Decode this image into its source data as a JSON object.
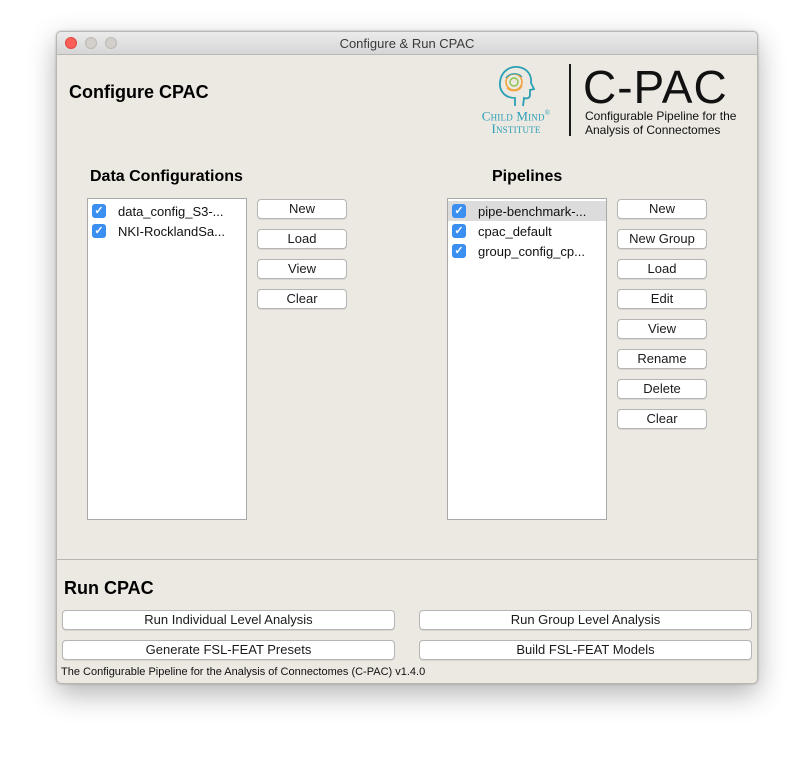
{
  "window": {
    "title": "Configure & Run CPAC"
  },
  "header": {
    "title": "Configure CPAC"
  },
  "logo": {
    "institute_line1": "Child Mind",
    "institute_line2": "Institute",
    "registered": "®",
    "product": "C-PAC",
    "subtitle_line1": "Configurable Pipeline for the",
    "subtitle_line2": "Analysis of Connectomes"
  },
  "data_configs": {
    "title": "Data Configurations",
    "items": [
      {
        "label": "data_config_S3-...",
        "checked": true
      },
      {
        "label": "NKI-RocklandSa...",
        "checked": true
      }
    ],
    "buttons": [
      "New",
      "Load",
      "View",
      "Clear"
    ]
  },
  "pipelines": {
    "title": "Pipelines",
    "items": [
      {
        "label": "pipe-benchmark-...",
        "checked": true,
        "selected": true
      },
      {
        "label": "cpac_default",
        "checked": true,
        "selected": false
      },
      {
        "label": "group_config_cp...",
        "checked": true,
        "selected": false
      }
    ],
    "buttons": [
      "New",
      "New Group",
      "Load",
      "Edit",
      "View",
      "Rename",
      "Delete",
      "Clear"
    ]
  },
  "run": {
    "title": "Run CPAC",
    "individual": "Run Individual Level Analysis",
    "group": "Run Group Level Analysis",
    "presets": "Generate FSL-FEAT Presets",
    "models": "Build FSL-FEAT Models"
  },
  "status": "The Configurable Pipeline for the Analysis of Connectomes (C-PAC) v1.4.0",
  "colors": {
    "checkbox": "#3b8ff0",
    "window_bg": "#ece8e2",
    "cmi_teal": "#2aa0b5",
    "close": "#fc5f57"
  }
}
